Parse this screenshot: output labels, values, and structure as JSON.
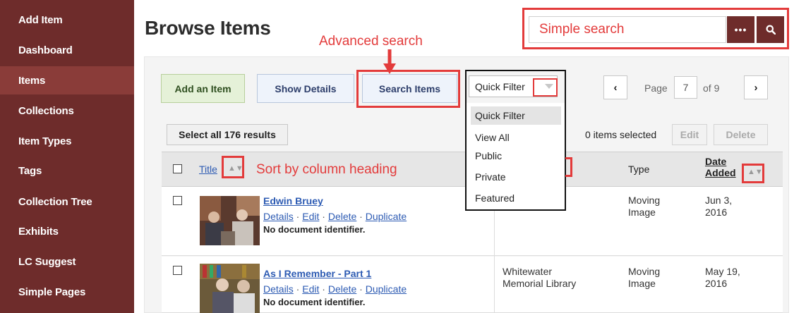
{
  "sidebar": {
    "items": [
      {
        "label": "Add Item"
      },
      {
        "label": "Dashboard"
      },
      {
        "label": "Items"
      },
      {
        "label": "Collections"
      },
      {
        "label": "Item Types"
      },
      {
        "label": "Tags"
      },
      {
        "label": "Collection Tree"
      },
      {
        "label": "Exhibits"
      },
      {
        "label": "LC Suggest"
      },
      {
        "label": "Simple Pages"
      }
    ],
    "active_index": 2,
    "color": "#6e2c2b"
  },
  "header": {
    "title": "Browse Items",
    "search_more_label": "•••",
    "search_icon": "magnifier-icon"
  },
  "annotations": {
    "simple_search": "Simple search",
    "advanced_search": "Advanced search",
    "sort_by_heading": "Sort by column heading",
    "color": "#e33b3b"
  },
  "toolbar": {
    "add_label": "Add an Item",
    "details_label": "Show Details",
    "search_label": "Search Items",
    "quick_filter": {
      "selected": "Quick Filter",
      "options": [
        "Quick Filter",
        "View All",
        "Public",
        "Private",
        "Featured"
      ]
    },
    "pagination": {
      "prev": "‹",
      "next": "›",
      "page_label": "Page",
      "current": "7",
      "of_label": "of 9"
    }
  },
  "selection": {
    "select_all_label": "Select all 176 results",
    "selected_text": "0 items selected",
    "edit_label": "Edit",
    "delete_label": "Delete"
  },
  "table": {
    "headers": {
      "title": "Title",
      "type": "Type",
      "date_line1": "Date",
      "date_line2": "Added"
    },
    "rows": [
      {
        "title": "Edwin Bruey",
        "actions": [
          "Details",
          "Edit",
          "Delete",
          "Duplicate"
        ],
        "note": "No document identifier.",
        "collection_line1": "",
        "collection_line2": "",
        "type_line1": "Moving",
        "type_line2": "Image",
        "date_line1": "Jun 3,",
        "date_line2": "2016"
      },
      {
        "title": "As I Remember - Part 1",
        "actions": [
          "Details",
          "Edit",
          "Delete",
          "Duplicate"
        ],
        "note": "No document identifier.",
        "collection_line1": "Whitewater",
        "collection_line2": "Memorial Library",
        "type_line1": "Moving",
        "type_line2": "Image",
        "date_line1": "May 19,",
        "date_line2": "2016"
      }
    ]
  }
}
